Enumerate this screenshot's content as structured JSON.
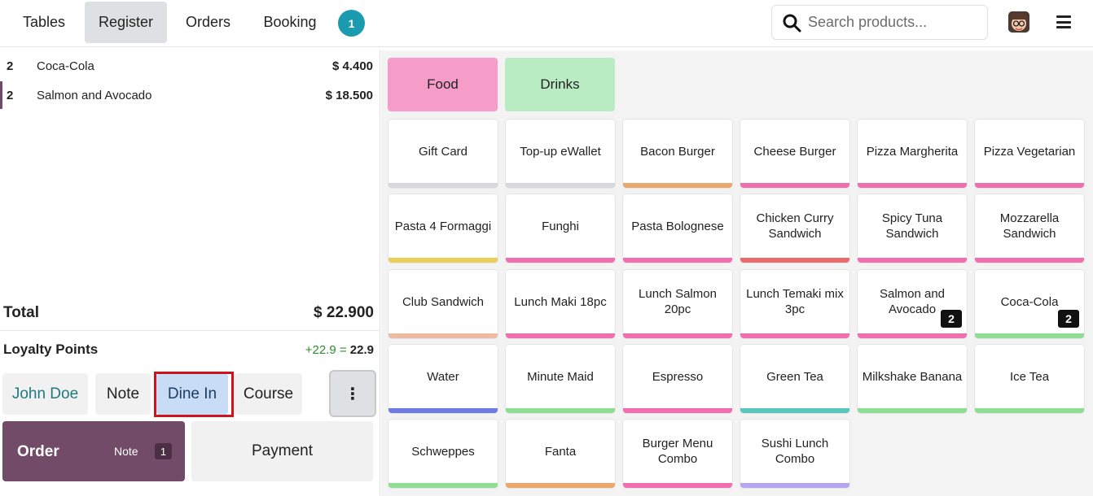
{
  "topbar": {
    "tabs": [
      {
        "label": "Tables"
      },
      {
        "label": "Register"
      },
      {
        "label": "Orders"
      },
      {
        "label": "Booking"
      }
    ],
    "booking_count": "1",
    "search_placeholder": "Search products..."
  },
  "order": {
    "lines": [
      {
        "qty": "2",
        "name": "Coca-Cola",
        "price": "$ 4.400"
      },
      {
        "qty": "2",
        "name": "Salmon and Avocado",
        "price": "$ 18.500"
      }
    ],
    "total_label": "Total",
    "total_value": "$ 22.900",
    "loyalty_label": "Loyalty Points",
    "loyalty_plus": "+22.9",
    "loyalty_eq": "=",
    "loyalty_total": "22.9"
  },
  "controls": {
    "customer": "John Doe",
    "note": "Note",
    "dine_in": "Dine In",
    "course": "Course",
    "more": "⋮"
  },
  "actions": {
    "order_label": "Order",
    "note_label": "Note",
    "note_count": "1",
    "payment_label": "Payment"
  },
  "categories": [
    {
      "label": "Food",
      "color": "#f59dc8"
    },
    {
      "label": "Drinks",
      "color": "#b9ecc2"
    }
  ],
  "products": [
    {
      "name": "Gift Card",
      "color": "#d9d9dd"
    },
    {
      "name": "Top-up eWallet",
      "color": "#d9d9dd"
    },
    {
      "name": "Bacon Burger",
      "color": "#eaa86f"
    },
    {
      "name": "Cheese Burger",
      "color": "#f06fae"
    },
    {
      "name": "Pizza Margherita",
      "color": "#f06fae"
    },
    {
      "name": "Pizza Vegetarian",
      "color": "#f06fae"
    },
    {
      "name": "Pasta 4 Formaggi",
      "color": "#e9cf57"
    },
    {
      "name": "Funghi",
      "color": "#f06fae"
    },
    {
      "name": "Pasta Bolognese",
      "color": "#f06fae"
    },
    {
      "name": "Chicken Curry Sandwich",
      "color": "#ee6b6b"
    },
    {
      "name": "Spicy Tuna Sandwich",
      "color": "#f06fae"
    },
    {
      "name": "Mozzarella Sandwich",
      "color": "#f06fae"
    },
    {
      "name": "Club Sandwich",
      "color": "#ebbba2"
    },
    {
      "name": "Lunch Maki 18pc",
      "color": "#f06fae"
    },
    {
      "name": "Lunch Salmon 20pc",
      "color": "#f06fae"
    },
    {
      "name": "Lunch Temaki mix 3pc",
      "color": "#f06fae"
    },
    {
      "name": "Salmon and Avocado",
      "color": "#f06fae",
      "qty": "2"
    },
    {
      "name": "Coca-Cola",
      "color": "#8fdc93",
      "qty": "2"
    },
    {
      "name": "Water",
      "color": "#6e7ce0"
    },
    {
      "name": "Minute Maid",
      "color": "#8fdc93"
    },
    {
      "name": "Espresso",
      "color": "#f06fae"
    },
    {
      "name": "Green Tea",
      "color": "#5ac6be"
    },
    {
      "name": "Milkshake Banana",
      "color": "#8fdc93"
    },
    {
      "name": "Ice Tea",
      "color": "#8fdc93"
    },
    {
      "name": "Schweppes",
      "color": "#8fdc93"
    },
    {
      "name": "Fanta",
      "color": "#eaa86f"
    },
    {
      "name": "Burger Menu Combo",
      "color": "#f06fae"
    },
    {
      "name": "Sushi Lunch Combo",
      "color": "#b6a6f0"
    }
  ]
}
